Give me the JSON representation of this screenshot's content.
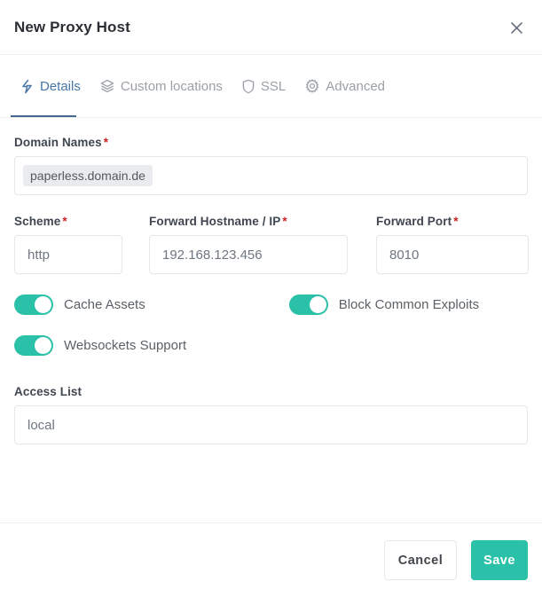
{
  "header": {
    "title": "New Proxy Host",
    "close_icon": "close-icon"
  },
  "tabs": [
    {
      "label": "Details",
      "icon": "bolt-icon",
      "active": true
    },
    {
      "label": "Custom locations",
      "icon": "layers-icon",
      "active": false
    },
    {
      "label": "SSL",
      "icon": "shield-icon",
      "active": false
    },
    {
      "label": "Advanced",
      "icon": "gear-icon",
      "active": false
    }
  ],
  "form": {
    "domain_names": {
      "label": "Domain Names",
      "required_marker": "*",
      "tags": [
        "paperless.domain.de"
      ]
    },
    "scheme": {
      "label": "Scheme",
      "required_marker": "*",
      "value": "http"
    },
    "forward_hostname": {
      "label": "Forward Hostname / IP",
      "required_marker": "*",
      "value": "192.168.123.456"
    },
    "forward_port": {
      "label": "Forward Port",
      "required_marker": "*",
      "value": "8010"
    },
    "toggles": [
      {
        "label": "Cache Assets",
        "on": true
      },
      {
        "label": "Block Common Exploits",
        "on": true
      },
      {
        "label": "Websockets Support",
        "on": true
      }
    ],
    "access_list": {
      "label": "Access List",
      "value": "local"
    }
  },
  "footer": {
    "cancel_label": "Cancel",
    "save_label": "Save"
  },
  "colors": {
    "accent_teal": "#2bc0a8",
    "tab_active_blue": "#4776a8",
    "required_red": "#cd201f",
    "tag_bg": "#e9ebee"
  }
}
